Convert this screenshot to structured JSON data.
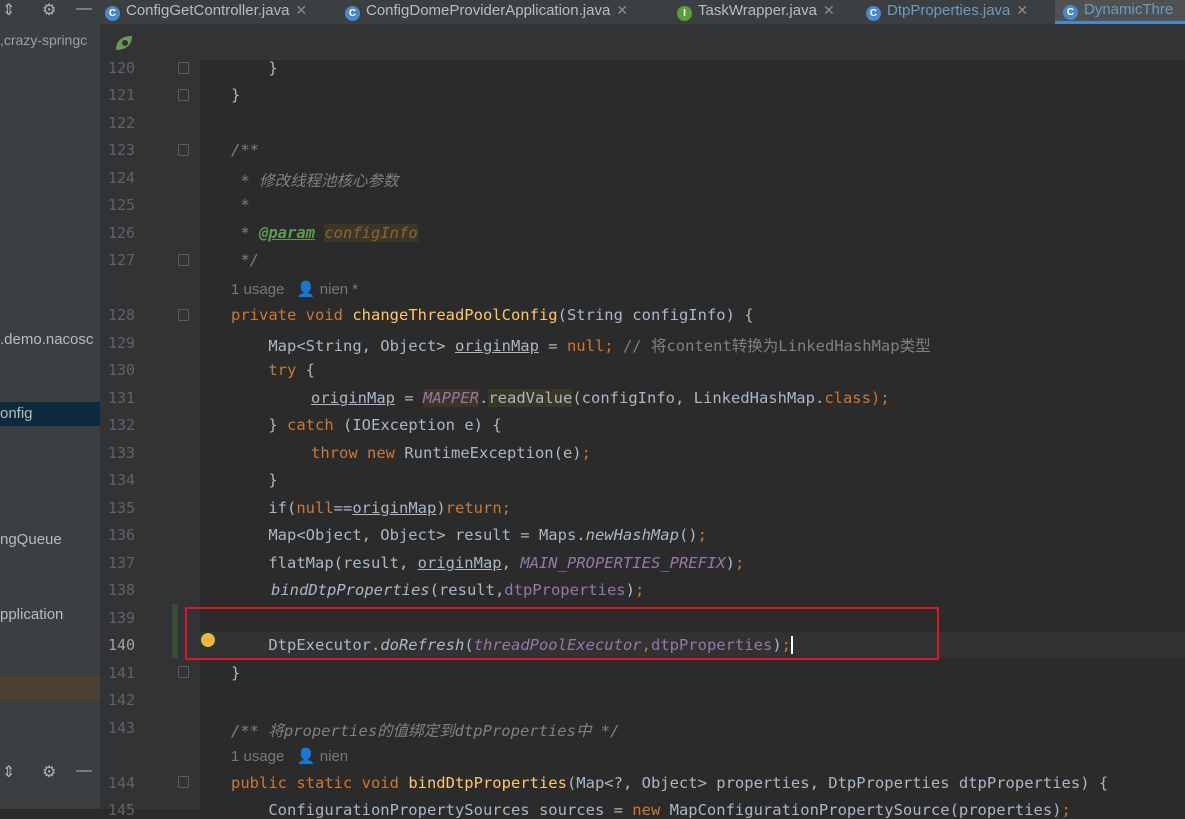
{
  "left_panel": {
    "project_label": ",crazy-springc",
    "items": [
      {
        "label": ".demo.nacosc"
      },
      {
        "label": "onfig"
      },
      {
        "label": "ngQueue"
      },
      {
        "label": "pplication"
      }
    ]
  },
  "tabs": [
    {
      "label": "ConfigGetController.java",
      "icon": "C",
      "color": "#4a88c7"
    },
    {
      "label": "ConfigDomeProviderApplication.java",
      "icon": "C",
      "color": "#4a88c7"
    },
    {
      "label": "TaskWrapper.java",
      "icon": "I",
      "color": "#5f9d3a"
    },
    {
      "label": "DtpProperties.java",
      "icon": "C",
      "color": "#4a88c7"
    },
    {
      "label": "DynamicThre",
      "icon": "C",
      "color": "#4a88c7"
    }
  ],
  "line_numbers": [
    "120",
    "121",
    "122",
    "123",
    "124",
    "125",
    "126",
    "127",
    "128",
    "129",
    "130",
    "131",
    "132",
    "133",
    "134",
    "135",
    "136",
    "137",
    "138",
    "139",
    "140",
    "141",
    "142",
    "143",
    "144",
    "145"
  ],
  "hints": {
    "h1_usage": "1 usage",
    "h1_author": "nien *",
    "h2_usage": "1 usage",
    "h2_author": "nien"
  },
  "code": {
    "c120": "    }",
    "c121": "}",
    "c123": "/**",
    "c124_a": " * ",
    "c124_b": "修改线程池核心参数",
    "c125": " *",
    "c126_a": " * ",
    "c126_tag": "@param",
    "c126_p": "configInfo",
    "c127": " */",
    "c128_kw": "private void ",
    "c128_fn": "changeThreadPoolConfig",
    "c128_rest": "(String configInfo) {",
    "c129_a": "    Map<String, Object> ",
    "c129_var": "originMap",
    "c129_b": " = ",
    "c129_null": "null",
    "c129_c": "; ",
    "c129_cm": "// 将content转换为LinkedHashMap类型",
    "c130_kw": "    try",
    "c130_b": " {",
    "c131_var": "originMap",
    "c131_eq": " = ",
    "c131_mapper": "MAPPER",
    "c131_dot": ".",
    "c131_fn": "readValue",
    "c131_rest": "(configInfo, LinkedHashMap.",
    "c131_cls": "class",
    "c131_end": ");",
    "c132_a": "    } ",
    "c132_kw": "catch",
    "c132_b": " (IOException e) {",
    "c133_kw": "throw new ",
    "c133_b": "RuntimeException(e)",
    "c133_end": ";",
    "c134": "    }",
    "c135_a": "    if(",
    "c135_null": "null",
    "c135_b": "==",
    "c135_var": "originMap",
    "c135_c": ")",
    "c135_ret": "return;",
    "c136_a": "    Map<Object, Object> result = Maps.",
    "c136_fn": "newHashMap",
    "c136_b": "()",
    "c136_end": ";",
    "c137_a": "    flatMap(result, ",
    "c137_var": "originMap",
    "c137_b": ", ",
    "c137_const": "MAIN_PROPERTIES_PREFIX",
    "c137_c": ")",
    "c137_end": ";",
    "c138_fn": "bindDtpProperties",
    "c138_a": "(result,",
    "c138_fld": "dtpProperties",
    "c138_b": ")",
    "c138_end": ";",
    "c140_a": "    DtpExecutor.",
    "c140_fn": "doRefresh",
    "c140_b": "(",
    "c140_fld1": "threadPoolExecutor",
    "c140_comma": ",",
    "c140_fld2": "dtpProperties",
    "c140_c": ")",
    "c140_end": ";",
    "c141": "}",
    "c143_cm": "/** 将properties的值绑定到dtpProperties中 */",
    "c144_kw": "public static void ",
    "c144_fn": "bindDtpProperties",
    "c144_rest": "(Map<?, Object> properties, DtpProperties dtpProperties) {",
    "c145_a": "    ConfigurationPropertySources sources = ",
    "c145_kw": "new ",
    "c145_b": "MapConfigurationPropertySource(properties)",
    "c145_end": ";"
  }
}
